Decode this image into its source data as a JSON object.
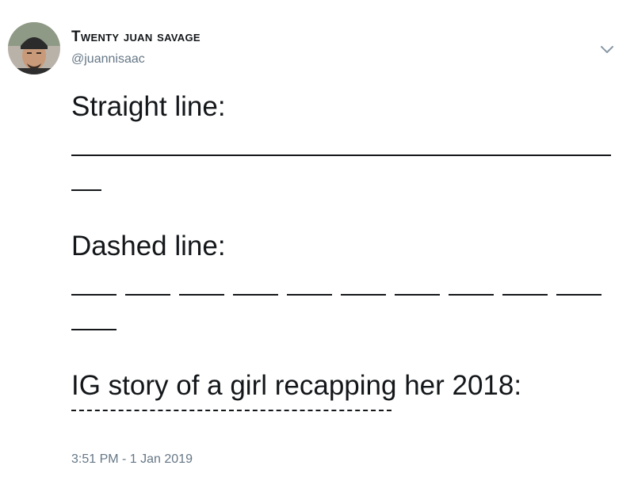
{
  "author": {
    "display_name": "Twenty juan savage",
    "handle": "@juannisaac",
    "avatar_icon": "profile-photo"
  },
  "menu": {
    "icon": "chevron-down-icon"
  },
  "tweet": {
    "line1": "Straight line:",
    "line2": "Dashed line:",
    "line3": "IG story of a girl recapping her 2018:"
  },
  "meta": {
    "timestamp": "3:51 PM - 1 Jan 2019"
  },
  "colors": {
    "text": "#14171a",
    "secondary": "#657786"
  }
}
